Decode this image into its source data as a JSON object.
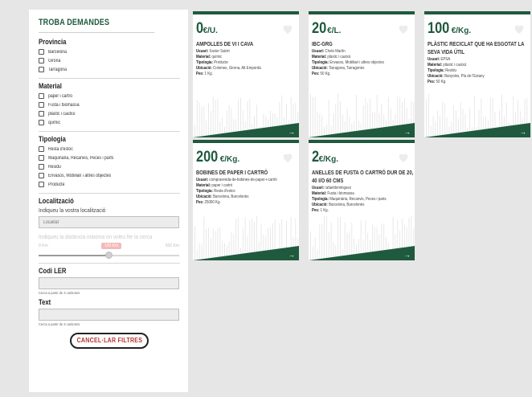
{
  "sidebar": {
    "title": "TROBA DEMANDES",
    "provincia": {
      "title": "Provincia",
      "items": [
        "Barcelona",
        "Girona",
        "Tarragona"
      ]
    },
    "material": {
      "title": "Material",
      "items": [
        "paper i cartró",
        "Fusta i biomassa",
        "plàstic i cautxú",
        "químic"
      ]
    },
    "tipologia": {
      "title": "Tipologia",
      "items": [
        "Resta d'estoc",
        "Maquinària, Recanvis, Peces i parts",
        "Residu",
        "Envasos, Mobiliari i altres objectes",
        "Producte"
      ]
    },
    "localitzacio": {
      "title": "Localització",
      "hint": "Indiqueu la vostra localització",
      "placeholder": "Localitat",
      "distance_hint": "Indiqueu la distància màxima on voleu fer la cerca",
      "range_min": "0 Km",
      "range_max": "500 Km",
      "range_value": "120 Km",
      "range_fraction": 0.5
    },
    "codi_ler": {
      "title": "Codi LER",
      "note": "Cerca a partir de 3 caràcters"
    },
    "text": {
      "title": "Text",
      "note": "Cerca a partir de 3 caràcters"
    },
    "cancel_label": "CANCEL·LAR FILTRES"
  },
  "labels": {
    "usuari": "Usuari:",
    "material": "Material:",
    "tipologia": "Tipologia:",
    "ubicacio": "Ubicació:",
    "pes": "Pes:"
  },
  "cards": [
    {
      "price": "0",
      "unit": "€/U.",
      "title": "AMPOLLES DE VI I CAVA",
      "usuari": "Xavier Salort",
      "material": "químic",
      "tipologia": "Producte",
      "ubicacio": "Colomes, Girona, Alt Empordà",
      "pes": "1 Kg."
    },
    {
      "price": "20",
      "unit": "€/L.",
      "title": "IBC-GRG",
      "usuari": "Chelo Martín",
      "material": "plàstic i cautxú",
      "tipologia": "Envasos, Mobiliari i altres objectes",
      "ubicacio": "Tarragona, Tarragonès",
      "pes": "50 Kg."
    },
    {
      "price": "100",
      "unit": "€/Kg.",
      "title": "PLÀSTIC RECICLAT QUE HA ESGOTAT LA SEVA VIDA ÚTIL",
      "usuari": "EPSA",
      "material": "plàstic i cautxú",
      "tipologia": "Residu",
      "ubicacio": "Banyoles, Pla de l'Estany",
      "pes": "50 Kg."
    },
    {
      "price": "200",
      "unit": "€/Kg.",
      "title": "BOBINES DE PAPER I CARTRÓ",
      "usuari": "compravenda-de-bobines-de-paper-i-cartró",
      "material": "paper i cartró",
      "tipologia": "Resta d'estoc",
      "ubicacio": "Barcelona, Barcelonès",
      "pes": "25000 Kg."
    },
    {
      "price": "2",
      "unit": "€/Kg.",
      "title": "ANELLES DE FUSTA O CARTRÓ DUR DE 20, 40 I/O 60 CMS",
      "usuari": "rafaeldominguez",
      "material": "Fusta i biomassa",
      "tipologia": "Maquinària, Recanvis, Peces i parts",
      "ubicacio": "Barcelona, Barcelonès",
      "pes": "1 Kg."
    }
  ],
  "colors": {
    "brand_green": "#1f5a3e",
    "accent_red": "#b5322f"
  },
  "icons": {
    "favorite": "heart-icon",
    "more": "arrow-right-icon"
  }
}
